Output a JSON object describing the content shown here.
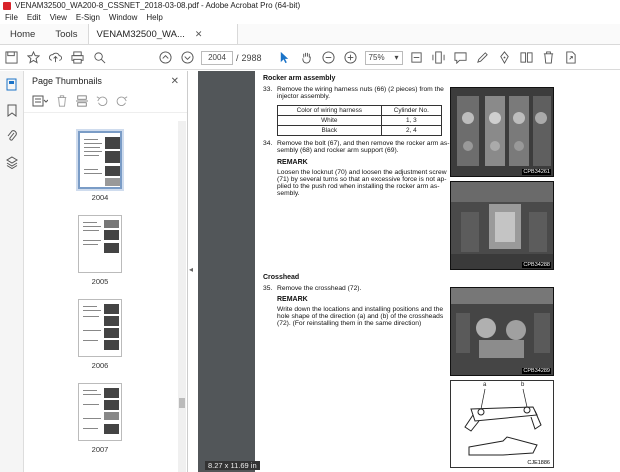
{
  "window": {
    "title": "VENAM32500_WA200-8_CSSNET_2018-03-08.pdf - Adobe Acrobat Pro (64-bit)"
  },
  "menu": [
    "File",
    "Edit",
    "View",
    "E-Sign",
    "Window",
    "Help"
  ],
  "tabs": {
    "home": "Home",
    "tools": "Tools",
    "document": "VENAM32500_WA..."
  },
  "toolbar": {
    "current_page": "2004",
    "page_sep": "/",
    "total_pages": "2988",
    "zoom": "75%"
  },
  "panel": {
    "title": "Page Thumbnails",
    "thumbnails": [
      {
        "label": "2004",
        "selected": true
      },
      {
        "label": "2005",
        "selected": false
      },
      {
        "label": "2006",
        "selected": false
      },
      {
        "label": "2007",
        "selected": false
      }
    ]
  },
  "page_size": "8.27 x 11.69 in",
  "doc": {
    "rocker_heading": "Rocker arm assembly",
    "step33_num": "33.",
    "step33_l1": "Remove the wiring harness nuts (66) (2 pieces) from the",
    "step33_l2": "injector assembly.",
    "table": {
      "h1": "Color of wiring harness",
      "h2": "Cylinder No.",
      "r1c1": "White",
      "r1c2": "1, 3",
      "r2c1": "Black",
      "r2c2": "2, 4"
    },
    "step34_num": "34.",
    "step34_l1": "Remove the bolt (67), and then remove the rocker arm as-",
    "step34_l2": "sembly (68) and rocker arm support (69).",
    "remark1": "REMARK",
    "remark1_l1": "Loosen the locknut (70) and loosen the adjustment screw",
    "remark1_l2": "(71) by several turns so that an excessive force is not ap-",
    "remark1_l3": "plied to the push rod when installing the rocker arm as-",
    "remark1_l4": "sembly.",
    "crosshead_heading": "Crosshead",
    "step35_num": "35.",
    "step35_l1": "Remove the crosshead (72).",
    "remark2": "REMARK",
    "remark2_l1": "Write down the locations and installing positions and the",
    "remark2_l2": "hole shape of the direction (a) and (b) of the crossheads",
    "remark2_l3": "(72). (For reinstalling them in the same direction)",
    "photo1_code": "CPB34261",
    "photo2_code": "CPB34288",
    "photo3_code": "CPB34289",
    "diagram_code": "CJE1886",
    "diagram_a": "a",
    "diagram_b": "b"
  }
}
